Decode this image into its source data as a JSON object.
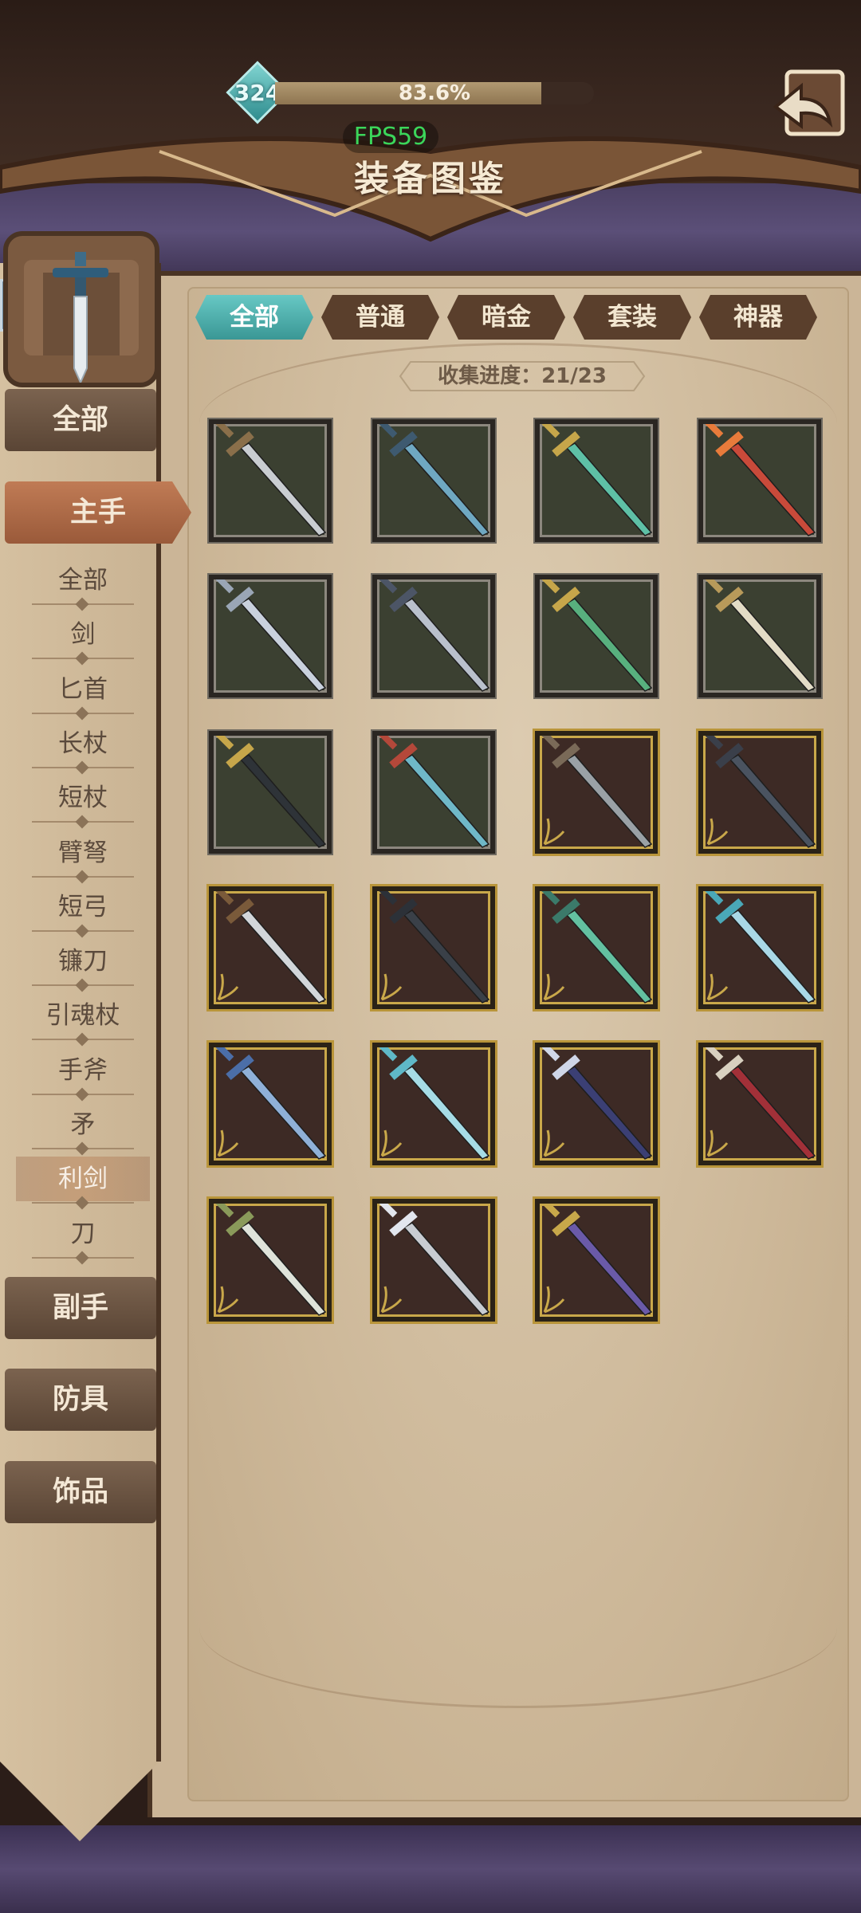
{
  "header": {
    "level": "324",
    "progress_text": "83.6%",
    "progress_value": 0.836,
    "fps": "FPS59",
    "title": "装备图鉴"
  },
  "tabs": [
    {
      "label": "全部",
      "active": true
    },
    {
      "label": "普通",
      "active": false
    },
    {
      "label": "暗金",
      "active": false
    },
    {
      "label": "套装",
      "active": false
    },
    {
      "label": "神器",
      "active": false
    }
  ],
  "collection": {
    "text": "收集进度：21/23"
  },
  "sidebar": {
    "category_all": "全部",
    "category_main": "主手",
    "category_offhand": "副手",
    "category_armor": "防具",
    "category_accessory": "饰品",
    "sub_items": [
      "全部",
      "剑",
      "匕首",
      "长杖",
      "短杖",
      "臂弩",
      "短弓",
      "镰刀",
      "引魂杖",
      "手斧",
      "矛",
      "利剑",
      "刀"
    ],
    "sub_active_index": 11
  },
  "items": [
    {
      "frame": "normal",
      "blade": "#c9cdd1",
      "hilt": "#8a6f4a"
    },
    {
      "frame": "normal",
      "blade": "#6fa8c2",
      "hilt": "#3e5a70"
    },
    {
      "frame": "normal",
      "blade": "#5ec0a6",
      "hilt": "#c6a64a"
    },
    {
      "frame": "normal",
      "blade": "#c94a3a",
      "hilt": "#e87b3b"
    },
    {
      "frame": "normal",
      "blade": "#c9d1dd",
      "hilt": "#9aa6b6"
    },
    {
      "frame": "normal",
      "blade": "#b9c0cc",
      "hilt": "#4c5566"
    },
    {
      "frame": "normal",
      "blade": "#58b07e",
      "hilt": "#c6a64a"
    },
    {
      "frame": "normal",
      "blade": "#e3dcc6",
      "hilt": "#b89a5a"
    },
    {
      "frame": "normal",
      "blade": "#2e3338",
      "hilt": "#c6a64a"
    },
    {
      "frame": "normal",
      "blade": "#6fb8c8",
      "hilt": "#b4483a"
    },
    {
      "frame": "dark",
      "blade": "#9aa1a6",
      "hilt": "#7a6a58"
    },
    {
      "frame": "dark",
      "blade": "#4a5360",
      "hilt": "#3a3f4a"
    },
    {
      "frame": "dark",
      "blade": "#d2d6da",
      "hilt": "#7a5a3a"
    },
    {
      "frame": "dark",
      "blade": "#3a4048",
      "hilt": "#2c3138"
    },
    {
      "frame": "dark",
      "blade": "#63c0a0",
      "hilt": "#3b7a6a"
    },
    {
      "frame": "dark",
      "blade": "#a9d8e6",
      "hilt": "#4aa8b8"
    },
    {
      "frame": "dark",
      "blade": "#8fb0d8",
      "hilt": "#4b6ea8"
    },
    {
      "frame": "dark",
      "blade": "#a6dce6",
      "hilt": "#5fb8c8"
    },
    {
      "frame": "dark",
      "blade": "#3b3f74",
      "hilt": "#cfd6e8"
    },
    {
      "frame": "dark",
      "blade": "#a23038",
      "hilt": "#d8d0c0"
    },
    {
      "frame": "dark",
      "blade": "#dfe3da",
      "hilt": "#8a9a5a"
    },
    {
      "frame": "dark",
      "blade": "#c8ccd2",
      "hilt": "#e2e6ee"
    },
    {
      "frame": "dark",
      "blade": "#6a5aa8",
      "hilt": "#c8a84a"
    }
  ],
  "colors": {
    "accent_teal": "#4fb3b0",
    "panel": "#cbb597",
    "frame_gold": "#c9a84a"
  }
}
